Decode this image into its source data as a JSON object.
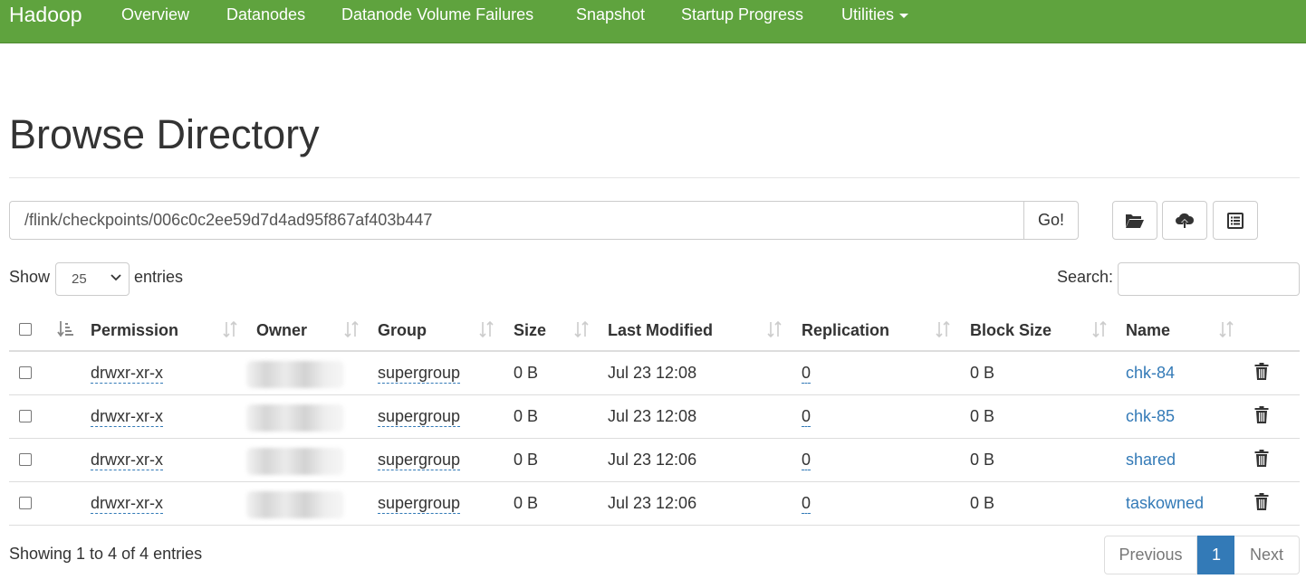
{
  "navbar": {
    "brand": "Hadoop",
    "items": [
      "Overview",
      "Datanodes",
      "Datanode Volume Failures",
      "Snapshot",
      "Startup Progress",
      "Utilities"
    ],
    "color": "#5fa33e"
  },
  "page": {
    "title": "Browse Directory"
  },
  "path": {
    "value": "/flink/checkpoints/006c0c2ee59d7d4ad95f867af403b447",
    "go_label": "Go!"
  },
  "toolbar": {
    "icons": [
      "folder-open-icon",
      "cloud-upload-icon",
      "list-alt-icon"
    ]
  },
  "length": {
    "show_label": "Show",
    "value": "25",
    "entries_label": "entries"
  },
  "search": {
    "label": "Search:",
    "value": ""
  },
  "table": {
    "columns": [
      "Permission",
      "Owner",
      "Group",
      "Size",
      "Last Modified",
      "Replication",
      "Block Size",
      "Name"
    ],
    "rows": [
      {
        "permission": "drwxr-xr-x",
        "group": "supergroup",
        "size": "0 B",
        "modified": "Jul 23 12:08",
        "replication": "0",
        "block_size": "0 B",
        "name": "chk-84"
      },
      {
        "permission": "drwxr-xr-x",
        "group": "supergroup",
        "size": "0 B",
        "modified": "Jul 23 12:08",
        "replication": "0",
        "block_size": "0 B",
        "name": "chk-85"
      },
      {
        "permission": "drwxr-xr-x",
        "group": "supergroup",
        "size": "0 B",
        "modified": "Jul 23 12:06",
        "replication": "0",
        "block_size": "0 B",
        "name": "shared"
      },
      {
        "permission": "drwxr-xr-x",
        "group": "supergroup",
        "size": "0 B",
        "modified": "Jul 23 12:06",
        "replication": "0",
        "block_size": "0 B",
        "name": "taskowned"
      }
    ]
  },
  "footer": {
    "info": "Showing 1 to 4 of 4 entries",
    "previous": "Previous",
    "current_page": "1",
    "next": "Next"
  },
  "colors": {
    "link": "#337ab7",
    "active_page": "#337ab7"
  }
}
